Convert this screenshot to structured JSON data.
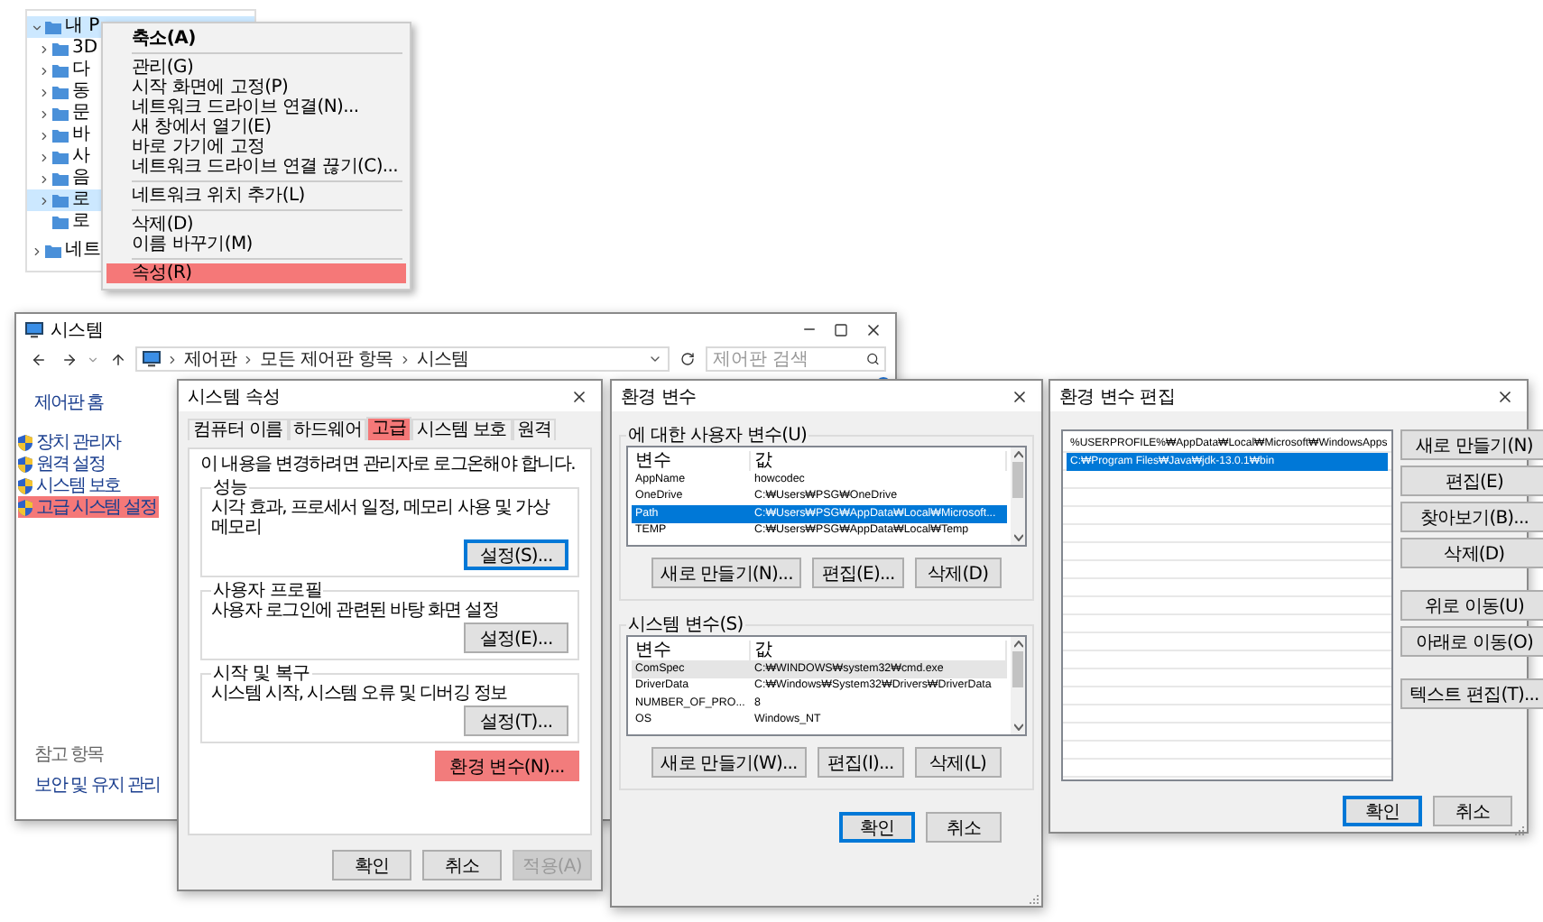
{
  "explorer_tree": {
    "items": [
      {
        "label": "내 P",
        "expanded": true,
        "selected": true,
        "children": [
          {
            "label": "3D",
            "expanded": false,
            "selected": false
          },
          {
            "label": "다",
            "expanded": false,
            "selected": false
          },
          {
            "label": "동",
            "expanded": false,
            "selected": false
          },
          {
            "label": "문",
            "expanded": false,
            "selected": false
          },
          {
            "label": "바",
            "expanded": false,
            "selected": false
          },
          {
            "label": "사",
            "expanded": false,
            "selected": false
          },
          {
            "label": "음",
            "expanded": false,
            "selected": false
          },
          {
            "label": "로",
            "expanded": false,
            "selected": true
          },
          {
            "label": "로",
            "selected": false
          }
        ]
      },
      {
        "label": "네트",
        "expanded": false,
        "selected": false
      }
    ]
  },
  "context_menu": {
    "items": [
      {
        "kind": "item",
        "label": "축소(A)",
        "default": true,
        "highlighted": false
      },
      {
        "kind": "separator"
      },
      {
        "kind": "item",
        "label": "관리(G)",
        "default": false,
        "highlighted": false
      },
      {
        "kind": "item",
        "label": "시작 화면에 고정(P)",
        "default": false,
        "highlighted": false
      },
      {
        "kind": "item",
        "label": "네트워크 드라이브 연결(N)...",
        "default": false,
        "highlighted": false
      },
      {
        "kind": "item",
        "label": "새 창에서 열기(E)",
        "default": false,
        "highlighted": false
      },
      {
        "kind": "item",
        "label": "바로 가기에 고정",
        "default": false,
        "highlighted": false
      },
      {
        "kind": "item",
        "label": "네트워크 드라이브 연결 끊기(C)...",
        "default": false,
        "highlighted": false
      },
      {
        "kind": "separator"
      },
      {
        "kind": "item",
        "label": "네트워크 위치 추가(L)",
        "default": false,
        "highlighted": false
      },
      {
        "kind": "separator"
      },
      {
        "kind": "item",
        "label": "삭제(D)",
        "default": false,
        "highlighted": false
      },
      {
        "kind": "item",
        "label": "이름 바꾸기(M)",
        "default": false,
        "highlighted": false
      },
      {
        "kind": "separator"
      },
      {
        "kind": "item",
        "label": "속성(R)",
        "default": false,
        "highlighted": true
      }
    ]
  },
  "system_window": {
    "title": "시스템",
    "breadcrumb": [
      "제어판",
      "모든 제어판 항목",
      "시스템"
    ],
    "search": {
      "placeholder": "제어판 검색"
    },
    "sidebar": {
      "home": "제어판 홈",
      "tasks": [
        {
          "label": "장치 관리자",
          "highlighted": false
        },
        {
          "label": "원격 설정",
          "highlighted": false
        },
        {
          "label": "시스템 보호",
          "highlighted": false
        },
        {
          "label": "고급 시스템 설정",
          "highlighted": true
        }
      ],
      "see_also": {
        "heading": "참고 항목",
        "links": [
          "보안 및 유지 관리"
        ]
      }
    }
  },
  "system_properties": {
    "title": "시스템 속성",
    "tabs": [
      {
        "label": "컴퓨터 이름",
        "selected": false,
        "highlighted": false
      },
      {
        "label": "하드웨어",
        "selected": false,
        "highlighted": false
      },
      {
        "label": "고급",
        "selected": true,
        "highlighted": true
      },
      {
        "label": "시스템 보호",
        "selected": false,
        "highlighted": false
      },
      {
        "label": "원격",
        "selected": false,
        "highlighted": false
      }
    ],
    "notice": "이 내용을 변경하려면 관리자로 로그온해야 합니다.",
    "groups": [
      {
        "legend": "성능",
        "description": "시각 효과, 프로세서 일정, 메모리 사용 및 가상 메모리",
        "button": "설정(S)...",
        "default": true
      },
      {
        "legend": "사용자 프로필",
        "description": "사용자 로그인에 관련된 바탕 화면 설정",
        "button": "설정(E)...",
        "default": false
      },
      {
        "legend": "시작 및 복구",
        "description": "시스템 시작, 시스템 오류 및 디버깅 정보",
        "button": "설정(T)...",
        "default": false
      }
    ],
    "env_button": {
      "label": "환경 변수(N)...",
      "highlighted": true
    },
    "buttons": [
      {
        "label": "확인",
        "disabled": false
      },
      {
        "label": "취소",
        "disabled": false
      },
      {
        "label": "적용(A)",
        "disabled": true
      }
    ]
  },
  "environment_variables": {
    "title": "환경 변수",
    "sections": [
      {
        "legend": "에 대한 사용자 변수(U)",
        "focused": true,
        "columns": [
          "변수",
          "값"
        ],
        "rows": [
          {
            "name": "AppName",
            "value": "howcodec",
            "selected": false
          },
          {
            "name": "OneDrive",
            "value": "C:₩Users₩PSG₩OneDrive",
            "selected": false
          },
          {
            "name": "Path",
            "value": "C:₩Users₩PSG₩AppData₩Local₩Microsoft...",
            "selected": true
          },
          {
            "name": "TEMP",
            "value": "C:₩Users₩PSG₩AppData₩Local₩Temp",
            "selected": false
          }
        ],
        "buttons": [
          "새로 만들기(N)...",
          "편집(E)...",
          "삭제(D)"
        ]
      },
      {
        "legend": "시스템 변수(S)",
        "focused": false,
        "columns": [
          "변수",
          "값"
        ],
        "rows": [
          {
            "name": "ComSpec",
            "value": "C:₩WINDOWS₩system32₩cmd.exe",
            "selected": true
          },
          {
            "name": "DriverData",
            "value": "C:₩Windows₩System32₩Drivers₩DriverData",
            "selected": false
          },
          {
            "name": "NUMBER_OF_PRO...",
            "value": "8",
            "selected": false
          },
          {
            "name": "OS",
            "value": "Windows_NT",
            "selected": false
          }
        ],
        "buttons": [
          "새로 만들기(W)...",
          "편집(I)...",
          "삭제(L)"
        ]
      }
    ],
    "buttons": [
      {
        "label": "확인",
        "default": true
      },
      {
        "label": "취소",
        "default": false
      }
    ]
  },
  "edit_environment_variable": {
    "title": "환경 변수 편집",
    "entries": [
      {
        "value": "%USERPROFILE%₩AppData₩Local₩Microsoft₩WindowsApps",
        "selected": false
      },
      {
        "value": "C:₩Program Files₩Java₩jdk-13.0.1₩bin",
        "selected": true
      }
    ],
    "button_groups": [
      [
        "새로 만들기(N)",
        "편집(E)",
        "찾아보기(B)...",
        "삭제(D)"
      ],
      [
        "위로 이동(U)",
        "아래로 이동(O)"
      ],
      [
        "텍스트 편집(T)..."
      ]
    ],
    "buttons": [
      {
        "label": "확인",
        "default": true
      },
      {
        "label": "취소",
        "default": false
      }
    ]
  }
}
